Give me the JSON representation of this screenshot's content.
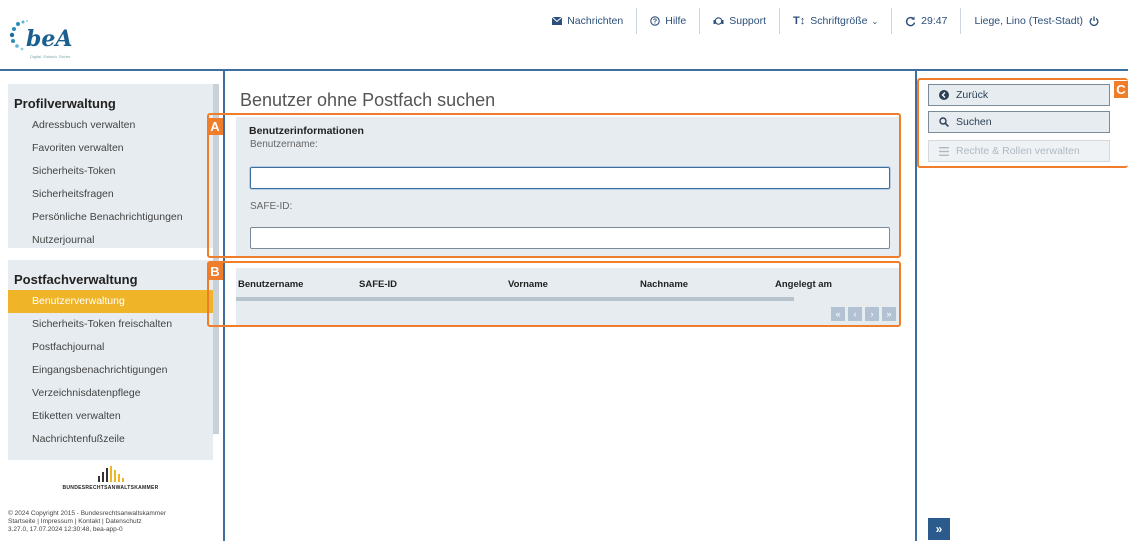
{
  "header": {
    "logo_text": "beA",
    "logo_tagline": "Digital. Einfach. Sicher.",
    "nav": {
      "messages": "Nachrichten",
      "help": "Hilfe",
      "support": "Support",
      "font_size": "Schriftgröße",
      "timer": "29:47",
      "user": "Liege, Lino (Test-Stadt)"
    }
  },
  "sidebar": {
    "profile_title": "Profilverwaltung",
    "profile_items": [
      "Adressbuch verwalten",
      "Favoriten verwalten",
      "Sicherheits-Token",
      "Sicherheitsfragen",
      "Persönliche Benachrichtigungen",
      "Nutzerjournal"
    ],
    "mailbox_title": "Postfachverwaltung",
    "mailbox_items": [
      "Benutzerverwaltung",
      "Sicherheits-Token freischalten",
      "Postfachjournal",
      "Eingangsbenachrichtigungen",
      "Verzeichnisdatenpflege",
      "Etiketten verwalten",
      "Nachrichtenfußzeile"
    ],
    "brak_name": "BUNDESRECHTSANWALTSKAMMER",
    "footer": {
      "copyright": "© 2024 Copyright 2015 - Bundesrechtsanwaltskammer",
      "links": "Startseite | Impressum | Kontakt | Datenschutz",
      "version": "3.27.0, 17.07.2024 12:30:48, bea-app-0"
    }
  },
  "main": {
    "page_title": "Benutzer ohne Postfach suchen",
    "form": {
      "heading": "Benutzerinformationen",
      "username_label": "Benutzername:",
      "username_value": "",
      "safe_id_label": "SAFE-ID:",
      "safe_id_value": ""
    },
    "table": {
      "columns": [
        "Benutzername",
        "SAFE-ID",
        "Vorname",
        "Nachname",
        "Angelegt am"
      ],
      "rows": []
    },
    "pager": [
      "«",
      "‹",
      "›",
      "»"
    ]
  },
  "actions": {
    "back": "Zurück",
    "search": "Suchen",
    "roles": "Rechte & Rollen verwalten",
    "expand": "»"
  },
  "annotations": {
    "a": "A",
    "b": "B",
    "c": "C"
  },
  "colors": {
    "accent": "#3d6e9e",
    "active_item": "#f0b428",
    "annotation": "#f07d2a",
    "panel": "#e6ecf0"
  }
}
